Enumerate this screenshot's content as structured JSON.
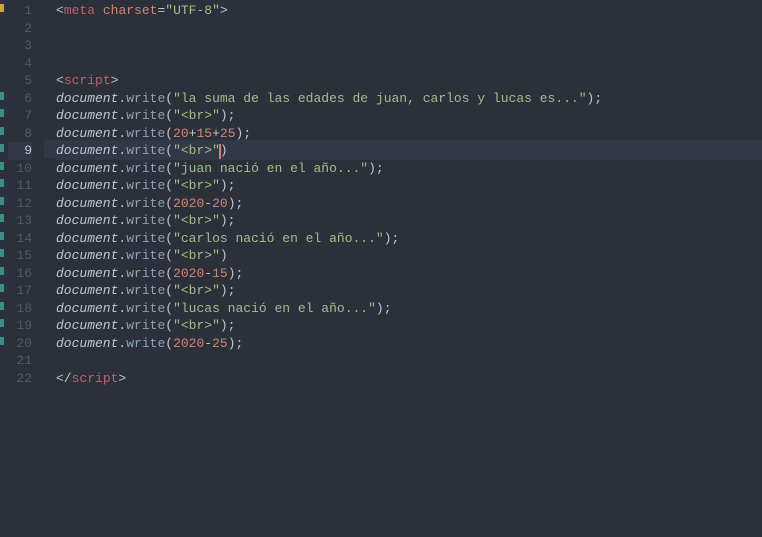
{
  "activeLine": 9,
  "cursorAfterCharIndex": 21,
  "gutterMarks": [
    {
      "line": 1,
      "color": "yellow"
    },
    {
      "line": 6,
      "color": "teal"
    },
    {
      "line": 7,
      "color": "teal"
    },
    {
      "line": 8,
      "color": "teal"
    },
    {
      "line": 9,
      "color": "teal"
    },
    {
      "line": 10,
      "color": "teal"
    },
    {
      "line": 11,
      "color": "teal"
    },
    {
      "line": 12,
      "color": "teal"
    },
    {
      "line": 13,
      "color": "teal"
    },
    {
      "line": 14,
      "color": "teal"
    },
    {
      "line": 15,
      "color": "teal"
    },
    {
      "line": 16,
      "color": "teal"
    },
    {
      "line": 17,
      "color": "teal"
    },
    {
      "line": 18,
      "color": "teal"
    },
    {
      "line": 19,
      "color": "teal"
    },
    {
      "line": 20,
      "color": "teal"
    }
  ],
  "lines": [
    {
      "n": 1,
      "tokens": [
        [
          "punct",
          "<"
        ],
        [
          "tag",
          "meta"
        ],
        [
          "punct",
          " "
        ],
        [
          "attr",
          "charset"
        ],
        [
          "punct",
          "="
        ],
        [
          "string",
          "\"UTF-8\""
        ],
        [
          "punct",
          ">"
        ]
      ]
    },
    {
      "n": 2,
      "tokens": []
    },
    {
      "n": 3,
      "tokens": []
    },
    {
      "n": 4,
      "tokens": []
    },
    {
      "n": 5,
      "tokens": [
        [
          "punct",
          "<"
        ],
        [
          "tag",
          "script"
        ],
        [
          "punct",
          ">"
        ]
      ]
    },
    {
      "n": 6,
      "tokens": [
        [
          "ident",
          "document"
        ],
        [
          "punct",
          "."
        ],
        [
          "method",
          "write"
        ],
        [
          "punct",
          "("
        ],
        [
          "string",
          "\"la suma de las edades de juan, carlos y lucas es...\""
        ],
        [
          "punct",
          ");"
        ]
      ]
    },
    {
      "n": 7,
      "tokens": [
        [
          "ident",
          "document"
        ],
        [
          "punct",
          "."
        ],
        [
          "method",
          "write"
        ],
        [
          "punct",
          "("
        ],
        [
          "string",
          "\"<br>\""
        ],
        [
          "punct",
          ");"
        ]
      ]
    },
    {
      "n": 8,
      "tokens": [
        [
          "ident",
          "document"
        ],
        [
          "punct",
          "."
        ],
        [
          "method",
          "write"
        ],
        [
          "punct",
          "("
        ],
        [
          "number",
          "20"
        ],
        [
          "op",
          "+"
        ],
        [
          "number",
          "15"
        ],
        [
          "op",
          "+"
        ],
        [
          "number",
          "25"
        ],
        [
          "punct",
          ");"
        ]
      ]
    },
    {
      "n": 9,
      "tokens": [
        [
          "ident",
          "document"
        ],
        [
          "punct",
          "."
        ],
        [
          "method",
          "write"
        ],
        [
          "punct",
          "("
        ],
        [
          "string",
          "\"<br>\""
        ],
        [
          "punct",
          ")"
        ]
      ]
    },
    {
      "n": 10,
      "tokens": [
        [
          "ident",
          "document"
        ],
        [
          "punct",
          "."
        ],
        [
          "method",
          "write"
        ],
        [
          "punct",
          "("
        ],
        [
          "string",
          "\"juan nació en el año...\""
        ],
        [
          "punct",
          ");"
        ]
      ]
    },
    {
      "n": 11,
      "tokens": [
        [
          "ident",
          "document"
        ],
        [
          "punct",
          "."
        ],
        [
          "method",
          "write"
        ],
        [
          "punct",
          "("
        ],
        [
          "string",
          "\"<br>\""
        ],
        [
          "punct",
          ");"
        ]
      ]
    },
    {
      "n": 12,
      "tokens": [
        [
          "ident",
          "document"
        ],
        [
          "punct",
          "."
        ],
        [
          "method",
          "write"
        ],
        [
          "punct",
          "("
        ],
        [
          "number",
          "2020"
        ],
        [
          "op",
          "-"
        ],
        [
          "number",
          "20"
        ],
        [
          "punct",
          ");"
        ]
      ]
    },
    {
      "n": 13,
      "tokens": [
        [
          "ident",
          "document"
        ],
        [
          "punct",
          "."
        ],
        [
          "method",
          "write"
        ],
        [
          "punct",
          "("
        ],
        [
          "string",
          "\"<br>\""
        ],
        [
          "punct",
          ");"
        ]
      ]
    },
    {
      "n": 14,
      "tokens": [
        [
          "ident",
          "document"
        ],
        [
          "punct",
          "."
        ],
        [
          "method",
          "write"
        ],
        [
          "punct",
          "("
        ],
        [
          "string",
          "\"carlos nació en el año...\""
        ],
        [
          "punct",
          ");"
        ]
      ]
    },
    {
      "n": 15,
      "tokens": [
        [
          "ident",
          "document"
        ],
        [
          "punct",
          "."
        ],
        [
          "method",
          "write"
        ],
        [
          "punct",
          "("
        ],
        [
          "string",
          "\"<br>\""
        ],
        [
          "punct",
          ")"
        ]
      ]
    },
    {
      "n": 16,
      "tokens": [
        [
          "ident",
          "document"
        ],
        [
          "punct",
          "."
        ],
        [
          "method",
          "write"
        ],
        [
          "punct",
          "("
        ],
        [
          "number",
          "2020"
        ],
        [
          "op",
          "-"
        ],
        [
          "number",
          "15"
        ],
        [
          "punct",
          ");"
        ]
      ]
    },
    {
      "n": 17,
      "tokens": [
        [
          "ident",
          "document"
        ],
        [
          "punct",
          "."
        ],
        [
          "method",
          "write"
        ],
        [
          "punct",
          "("
        ],
        [
          "string",
          "\"<br>\""
        ],
        [
          "punct",
          ");"
        ]
      ]
    },
    {
      "n": 18,
      "tokens": [
        [
          "ident",
          "document"
        ],
        [
          "punct",
          "."
        ],
        [
          "method",
          "write"
        ],
        [
          "punct",
          "("
        ],
        [
          "string",
          "\"lucas nació en el año...\""
        ],
        [
          "punct",
          ");"
        ]
      ]
    },
    {
      "n": 19,
      "tokens": [
        [
          "ident",
          "document"
        ],
        [
          "punct",
          "."
        ],
        [
          "method",
          "write"
        ],
        [
          "punct",
          "("
        ],
        [
          "string",
          "\"<br>\""
        ],
        [
          "punct",
          ");"
        ]
      ]
    },
    {
      "n": 20,
      "tokens": [
        [
          "ident",
          "document"
        ],
        [
          "punct",
          "."
        ],
        [
          "method",
          "write"
        ],
        [
          "punct",
          "("
        ],
        [
          "number",
          "2020"
        ],
        [
          "op",
          "-"
        ],
        [
          "number",
          "25"
        ],
        [
          "punct",
          ");"
        ]
      ]
    },
    {
      "n": 21,
      "tokens": []
    },
    {
      "n": 22,
      "tokens": [
        [
          "punct",
          "</"
        ],
        [
          "tag",
          "script"
        ],
        [
          "punct",
          ">"
        ]
      ]
    }
  ]
}
